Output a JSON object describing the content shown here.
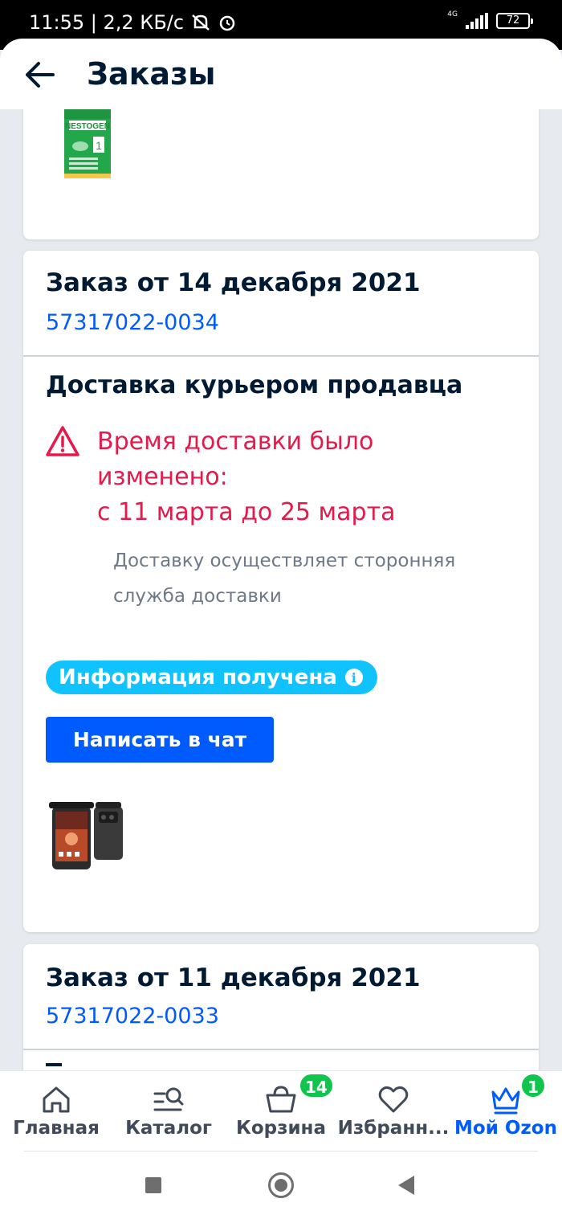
{
  "status_bar": {
    "time_speed": "11:55 | 2,2 КБ/с",
    "network": "4G",
    "battery": "72"
  },
  "header": {
    "title": "Заказы",
    "back_icon": "arrow-left-icon"
  },
  "orders": [
    {
      "product_image": "nestogen-formula-box"
    },
    {
      "title": "Заказ от 14 декабря 2021",
      "number": "57317022-0034",
      "delivery_title": "Доставка курьером продавца",
      "warning_lines": [
        "Время доставки было",
        "изменено:",
        "с 11 марта до 25 марта"
      ],
      "info_lines": [
        "Доставку осуществляет сторонняя",
        "служба доставки"
      ],
      "status_badge": "Информация получена",
      "chat_button": "Написать в чат",
      "product_image": "rugged-smartphone"
    },
    {
      "title": "Заказ от 11 декабря 2021",
      "number": "57317022-0033"
    }
  ],
  "bottom_nav": {
    "items": [
      {
        "label": "Главная",
        "icon": "home-icon"
      },
      {
        "label": "Каталог",
        "icon": "catalog-search-icon"
      },
      {
        "label": "Корзина",
        "icon": "basket-icon",
        "badge": "14"
      },
      {
        "label": "Избранн...",
        "icon": "heart-icon"
      },
      {
        "label": "Мой Ozon",
        "icon": "crown-icon",
        "badge": "1",
        "active": true
      }
    ]
  },
  "colors": {
    "accent": "#005bff",
    "warning": "#e6194b",
    "badge_info": "#10c3ff",
    "badge_count": "#10c44c"
  }
}
